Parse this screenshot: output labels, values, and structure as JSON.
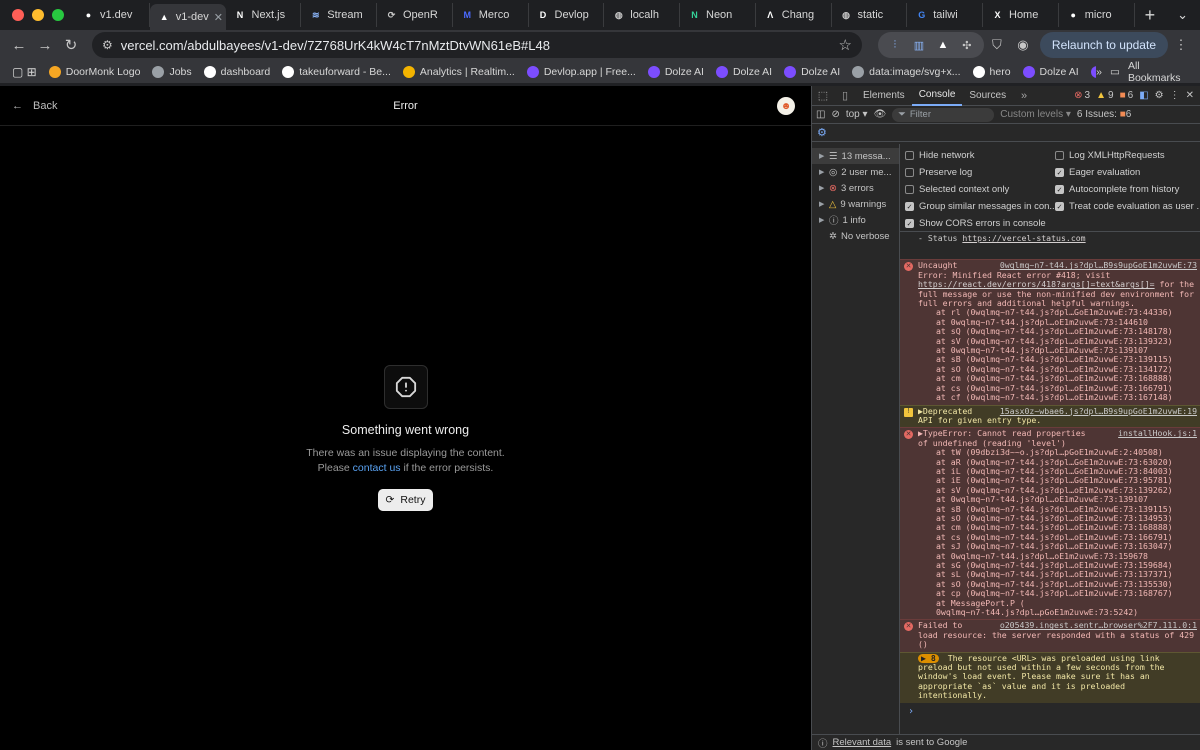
{
  "browser": {
    "tabs": [
      {
        "title": "v1.dev",
        "icon": "github-icon",
        "color": "#ffffff"
      },
      {
        "title": "v1-dev",
        "icon": "vercel-icon",
        "color": "#ffffff",
        "active": true
      },
      {
        "title": "Next.js",
        "icon": "nextjs-icon",
        "color": "#ffffff"
      },
      {
        "title": "Stream",
        "icon": "stream-icon",
        "color": "#8ab4f8"
      },
      {
        "title": "OpenR",
        "icon": "openrouter-icon",
        "color": "#c7c7c7"
      },
      {
        "title": "Merco",
        "icon": "m-icon",
        "color": "#4b6bff"
      },
      {
        "title": "Devlop",
        "icon": "devlop-icon",
        "color": "#ffffff"
      },
      {
        "title": "localh",
        "icon": "globe-icon",
        "color": "#c7c7c7"
      },
      {
        "title": "Neon",
        "icon": "neon-icon",
        "color": "#34d399"
      },
      {
        "title": "Chang",
        "icon": "a-icon",
        "color": "#ffffff"
      },
      {
        "title": "static",
        "icon": "globe-icon",
        "color": "#c7c7c7"
      },
      {
        "title": "tailwi",
        "icon": "google-icon",
        "color": "#4285f4"
      },
      {
        "title": "Home",
        "icon": "x-icon",
        "color": "#ffffff"
      },
      {
        "title": "micro",
        "icon": "github-icon",
        "color": "#ffffff"
      }
    ],
    "url": "vercel.com/abdulbayees/v1-dev/7Z768UrK4kW4cT7nMztDtvWN61eB#L48",
    "relaunch_label": "Relaunch to update",
    "bookmarks": [
      {
        "label": "DoorMonk Logo",
        "color": "#f5a623"
      },
      {
        "label": "Jobs",
        "color": "#9aa0a6"
      },
      {
        "label": "dashboard",
        "color": "#ffffff"
      },
      {
        "label": "takeuforward - Be...",
        "color": "#ffffff"
      },
      {
        "label": "Analytics | Realtim...",
        "color": "#f4b400"
      },
      {
        "label": "Devlop.app | Free...",
        "color": "#7c4dff"
      },
      {
        "label": "Dolze AI",
        "color": "#7c4dff"
      },
      {
        "label": "Dolze AI",
        "color": "#7c4dff"
      },
      {
        "label": "Dolze AI",
        "color": "#7c4dff"
      },
      {
        "label": "data:image/svg+x...",
        "color": "#9aa0a6"
      },
      {
        "label": "hero",
        "color": "#ffffff"
      },
      {
        "label": "Dolze AI",
        "color": "#7c4dff"
      },
      {
        "label": "Dolze AI",
        "color": "#7c4dff"
      }
    ],
    "all_bookmarks_label": "All Bookmarks"
  },
  "page": {
    "back_label": "Back",
    "title": "Error",
    "error_title": "Something went wrong",
    "error_line1": "There was an issue displaying the content.",
    "error_please": "Please ",
    "contact_link": "contact us",
    "error_suffix": " if the error persists.",
    "retry_label": "Retry"
  },
  "devtools": {
    "tabs": [
      "Elements",
      "Console",
      "Sources"
    ],
    "active_tab": "Console",
    "error_count": "3",
    "warning_count": "9",
    "issue_count": "6",
    "context": "top",
    "filter_placeholder": "Filter",
    "levels": "Custom levels",
    "issues_label": "6 Issues:",
    "issues_num": "6",
    "sidebar": [
      {
        "label": "13 messa...",
        "icon": "list-icon"
      },
      {
        "label": "2 user me...",
        "icon": "user-icon"
      },
      {
        "label": "3 errors",
        "icon": "error-icon"
      },
      {
        "label": "9 warnings",
        "icon": "warning-icon"
      },
      {
        "label": "1 info",
        "icon": "info-icon"
      },
      {
        "label": "No verbose",
        "icon": "bug-icon"
      }
    ],
    "settings": [
      {
        "label": "Hide network",
        "checked": false
      },
      {
        "label": "Log XMLHttpRequests",
        "checked": false
      },
      {
        "label": "Preserve log",
        "checked": false
      },
      {
        "label": "Eager evaluation",
        "checked": true
      },
      {
        "label": "Selected context only",
        "checked": false
      },
      {
        "label": "Autocomplete from history",
        "checked": true
      },
      {
        "label": "Group similar messages in con...",
        "checked": true
      },
      {
        "label": "Treat code evaluation as user ...",
        "checked": true
      },
      {
        "label": "Show CORS errors in console",
        "checked": true
      }
    ],
    "log": {
      "status_line": "- Status ",
      "status_link": "https://vercel-status.com",
      "err1_prefix": "Uncaught",
      "err1_src": "0wqlmq~n7-t44.js?dpl…B9s9upGoE1m2uvwE:73",
      "err1_msg": "Error: Minified React error #418; visit",
      "err1_link": "https://react.dev/errors/418?args[]=text&args[]=",
      "err1_rest": " for the full message or use the non-minified dev environment for full errors and additional helpful warnings.",
      "err1_stack": [
        "at rl (0wqlmq~n7-t44.js?dpl…GoE1m2uvwE:73:44336)",
        "at 0wqlmq~n7-t44.js?dpl…oE1m2uvwE:73:144610",
        "at sQ (0wqlmq~n7-t44.js?dpl…oE1m2uvwE:73:148178)",
        "at sV (0wqlmq~n7-t44.js?dpl…oE1m2uvwE:73:139323)",
        "at 0wqlmq~n7-t44.js?dpl…oE1m2uvwE:73:139107",
        "at sB (0wqlmq~n7-t44.js?dpl…oE1m2uvwE:73:139115)",
        "at sO (0wqlmq~n7-t44.js?dpl…oE1m2uvwE:73:134172)",
        "at cm (0wqlmq~n7-t44.js?dpl…oE1m2uvwE:73:168888)",
        "at cs (0wqlmq~n7-t44.js?dpl…oE1m2uvwE:73:166791)",
        "at cf (0wqlmq~n7-t44.js?dpl…oE1m2uvwE:73:167148)"
      ],
      "warn1_msg": "▶Deprecated",
      "warn1_src": "15asx0z~wbae6.js?dpl…B9s9upGoE1m2uvwE:19",
      "warn1_rest": "API for given entry type.",
      "err2_msg": "▶TypeError: Cannot read properties",
      "err2_src": "installHook.js:1",
      "err2_rest": "of undefined (reading 'level')",
      "err2_stack": [
        "at tW (09dbzi3d~~o.js?dpl…pGoE1m2uvwE:2:40508)",
        "at aR (0wqlmq~n7-t44.js?dpl…GoE1m2uvwE:73:63020)",
        "at iL (0wqlmq~n7-t44.js?dpl…GoE1m2uvwE:73:84003)",
        "at iE (0wqlmq~n7-t44.js?dpl…GoE1m2uvwE:73:95781)",
        "at sV (0wqlmq~n7-t44.js?dpl…oE1m2uvwE:73:139262)",
        "at 0wqlmq~n7-t44.js?dpl…oE1m2uvwE:73:139107",
        "at sB (0wqlmq~n7-t44.js?dpl…oE1m2uvwE:73:139115)",
        "at sO (0wqlmq~n7-t44.js?dpl…oE1m2uvwE:73:134953)",
        "at cm (0wqlmq~n7-t44.js?dpl…oE1m2uvwE:73:168888)",
        "at cs (0wqlmq~n7-t44.js?dpl…oE1m2uvwE:73:166791)",
        "at sJ (0wqlmq~n7-t44.js?dpl…oE1m2uvwE:73:163047)",
        "at 0wqlmq~n7-t44.js?dpl…oE1m2uvwE:73:159678",
        "at sG (0wqlmq~n7-t44.js?dpl…oE1m2uvwE:73:159684)",
        "at sL (0wqlmq~n7-t44.js?dpl…oE1m2uvwE:73:137371)",
        "at sO (0wqlmq~n7-t44.js?dpl…oE1m2uvwE:73:135530)",
        "at cp (0wqlmq~n7-t44.js?dpl…oE1m2uvwE:73:168767)",
        "at MessagePort.P (",
        "0wqlmq~n7-t44.js?dpl…pGoE1m2uvwE:73:5242)"
      ],
      "err3_msg": "Failed to",
      "err3_src": "o205439.ingest.sentr…browser%2F7.111.0:1",
      "err3_rest": "load resource: the server responded with a status of 429 ()",
      "warn2_badge": "8",
      "warn2_msg": "The resource <URL> was preloaded using link preload but not used within a few seconds from the window's load event. Please make sure it has an appropriate `as` value and it is preloaded intentionally."
    },
    "footer_link": "Relevant data",
    "footer_rest": "is sent to Google"
  },
  "colors": {
    "close": "#ff5f57",
    "minimize": "#febc2e",
    "zoom": "#28c840",
    "error": "#e46962",
    "warning": "#f2c53d",
    "link": "#5aa3f3"
  }
}
